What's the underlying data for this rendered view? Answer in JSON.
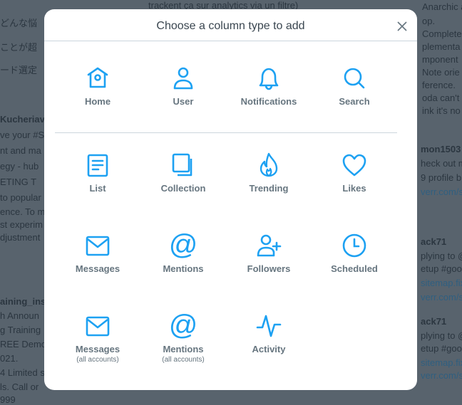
{
  "background": {
    "fragments": [
      "どんな悩",
      "ことが超",
      "ード選定",
      "Kucheriav",
      "ve your #S",
      "nt and ma",
      "egy - hub",
      "ETING T",
      "to popular",
      "ence. To m",
      "st experim",
      "djustment",
      "aining_inst",
      "h Announ",
      "g Training",
      "REE Demo",
      "021.",
      "4 Limited s",
      "ls. Call or",
      "999",
      "trackent ça sur analytics via un filtre)",
      "Anarchic an",
      "op.",
      "Complete",
      "plementa",
      "mponent",
      "Note orie",
      "ference.",
      "oda can't",
      "ink it's no",
      "mon1503",
      "heck out m",
      "9 profile b",
      "verr.com/s",
      "ack71",
      "plying to @",
      "etup #goo",
      "sitemap.fix",
      "verr.com/s",
      "ack71",
      "plying to @",
      "etup #goo",
      "sitemap.fix",
      "verr.com/s"
    ]
  },
  "modal": {
    "title": "Choose a column type to add",
    "close_icon": "close-icon",
    "accent_color": "#1da1f2",
    "items": [
      {
        "label": "Home",
        "icon": "home-icon"
      },
      {
        "label": "User",
        "icon": "user-icon"
      },
      {
        "label": "Notifications",
        "icon": "bell-icon"
      },
      {
        "label": "Search",
        "icon": "search-icon"
      },
      {
        "label": "List",
        "icon": "list-icon"
      },
      {
        "label": "Collection",
        "icon": "collection-icon"
      },
      {
        "label": "Trending",
        "icon": "flame-icon"
      },
      {
        "label": "Likes",
        "icon": "heart-icon"
      },
      {
        "label": "Messages",
        "icon": "envelope-icon"
      },
      {
        "label": "Mentions",
        "icon": "at-icon"
      },
      {
        "label": "Followers",
        "icon": "follow-icon"
      },
      {
        "label": "Scheduled",
        "icon": "clock-icon"
      },
      {
        "label": "Messages",
        "sublabel": "(all accounts)",
        "icon": "envelope-icon"
      },
      {
        "label": "Mentions",
        "sublabel": "(all accounts)",
        "icon": "at-icon"
      },
      {
        "label": "Activity",
        "icon": "activity-icon"
      }
    ]
  }
}
